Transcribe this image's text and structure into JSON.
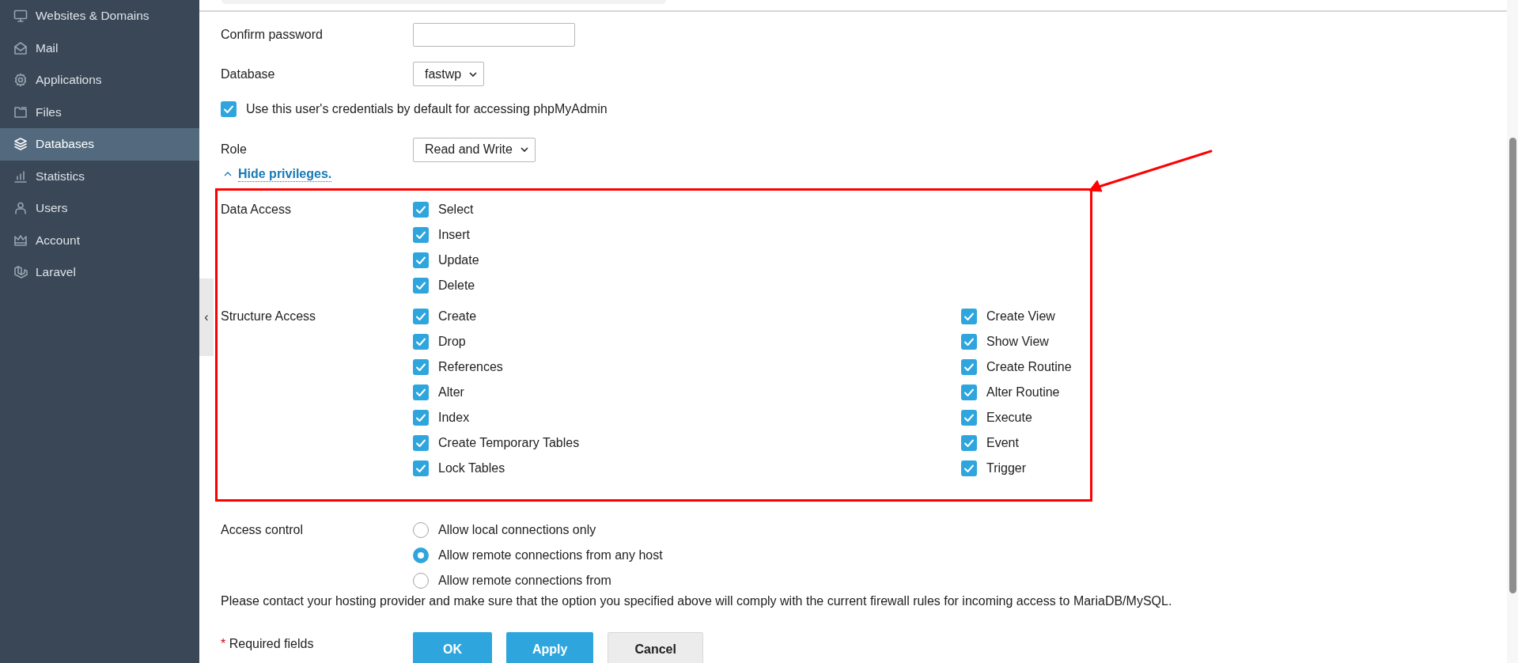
{
  "sidebar": {
    "items": [
      {
        "label": "Websites & Domains",
        "selected": false
      },
      {
        "label": "Mail",
        "selected": false
      },
      {
        "label": "Applications",
        "selected": false
      },
      {
        "label": "Files",
        "selected": false
      },
      {
        "label": "Databases",
        "selected": true
      },
      {
        "label": "Statistics",
        "selected": false
      },
      {
        "label": "Users",
        "selected": false
      },
      {
        "label": "Account",
        "selected": false
      },
      {
        "label": "Laravel",
        "selected": false
      }
    ]
  },
  "collapse_handle": {
    "label": "‹"
  },
  "form": {
    "confirm_password": {
      "label": "Confirm password"
    },
    "database": {
      "label": "Database",
      "value": "fastwp"
    },
    "default_credentials": {
      "label": "Use this user's credentials by default for accessing phpMyAdmin",
      "checked": true
    },
    "role": {
      "label": "Role",
      "value": "Read and Write"
    },
    "privileges_toggle": {
      "label": "Hide privileges.",
      "expanded": true
    },
    "privileges": [
      {
        "label": "Data Access",
        "columns": [
          [
            {
              "label": "Select",
              "checked": true
            },
            {
              "label": "Insert",
              "checked": true
            },
            {
              "label": "Update",
              "checked": true
            },
            {
              "label": "Delete",
              "checked": true
            }
          ]
        ]
      },
      {
        "label": "Structure Access",
        "columns": [
          [
            {
              "label": "Create",
              "checked": true
            },
            {
              "label": "Drop",
              "checked": true
            },
            {
              "label": "References",
              "checked": true
            },
            {
              "label": "Alter",
              "checked": true
            },
            {
              "label": "Index",
              "checked": true
            },
            {
              "label": "Create Temporary Tables",
              "checked": true
            },
            {
              "label": "Lock Tables",
              "checked": true
            }
          ],
          [
            {
              "label": "Create View",
              "checked": true
            },
            {
              "label": "Show View",
              "checked": true
            },
            {
              "label": "Create Routine",
              "checked": true
            },
            {
              "label": "Alter Routine",
              "checked": true
            },
            {
              "label": "Execute",
              "checked": true
            },
            {
              "label": "Event",
              "checked": true
            },
            {
              "label": "Trigger",
              "checked": true
            }
          ]
        ]
      }
    ],
    "access_control": {
      "label": "Access control",
      "options": [
        {
          "label": "Allow local connections only",
          "selected": false
        },
        {
          "label": "Allow remote connections from any host",
          "selected": true
        },
        {
          "label": "Allow remote connections from",
          "selected": false
        }
      ]
    },
    "note": "Please contact your hosting provider and make sure that the option you specified above will comply with the current firewall rules for incoming access to MariaDB/MySQL.",
    "required": {
      "mark": "*",
      "label": "Required fields"
    },
    "buttons": [
      {
        "label": "OK",
        "kind": "primary"
      },
      {
        "label": "Apply",
        "kind": "primary"
      },
      {
        "label": "Cancel",
        "kind": "secondary"
      }
    ]
  }
}
